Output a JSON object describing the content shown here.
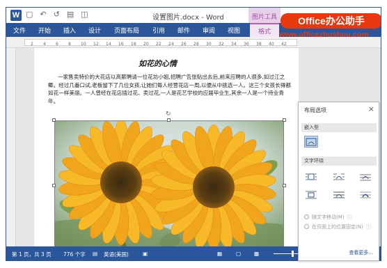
{
  "titlebar": {
    "app_icon": "W",
    "doc_title": "设置图片.docx - Word",
    "context_title": "图片工具",
    "qat_icons": [
      "save-icon",
      "undo-icon",
      "redo-icon",
      "print-icon",
      "open-folder-icon"
    ]
  },
  "brand": {
    "logo_text": "Office办公助手",
    "url": "www.officezhushou.com"
  },
  "ribbon": {
    "tabs": [
      "文件",
      "开始",
      "插入",
      "设计",
      "页面布局",
      "引用",
      "邮件",
      "审阅",
      "视图",
      "格式"
    ],
    "active_tab": "格式"
  },
  "ruler": {
    "ticks": [
      "2",
      "4",
      "6",
      "8",
      "10",
      "12",
      "14",
      "16",
      "18",
      "20",
      "22",
      "24",
      "26",
      "28",
      "30",
      "32",
      "34",
      "36",
      "38",
      "40",
      "42"
    ]
  },
  "document": {
    "heading": "如花的心情",
    "paragraph": "一家售卖特价的大花店以高薪聘请一位花坊小姐,招聘广告张贴出去后,前来应聘的人很多,如过江之鲫。经过几番口试,老板留下了几位女孩,让她们每人经营花店一周,以便从中挑选一人。这三个女孩长得都如花一样美丽。一人曾经在花店插过花、卖过花,一人是花艺学校的应届毕业生,其余一人是一个待业青年。"
  },
  "layout_panel": {
    "title": "布局选项",
    "close": "×",
    "section_inline": "嵌入型",
    "section_wrap": "文字环绕",
    "option_move": "随文字移动(M)",
    "option_fix": "在页面上的位置固定(N)",
    "see_more": "查看更多..."
  },
  "status": {
    "page": "第 1 页，共 3 页",
    "words": "776 个字",
    "language": "英语(美国)"
  }
}
